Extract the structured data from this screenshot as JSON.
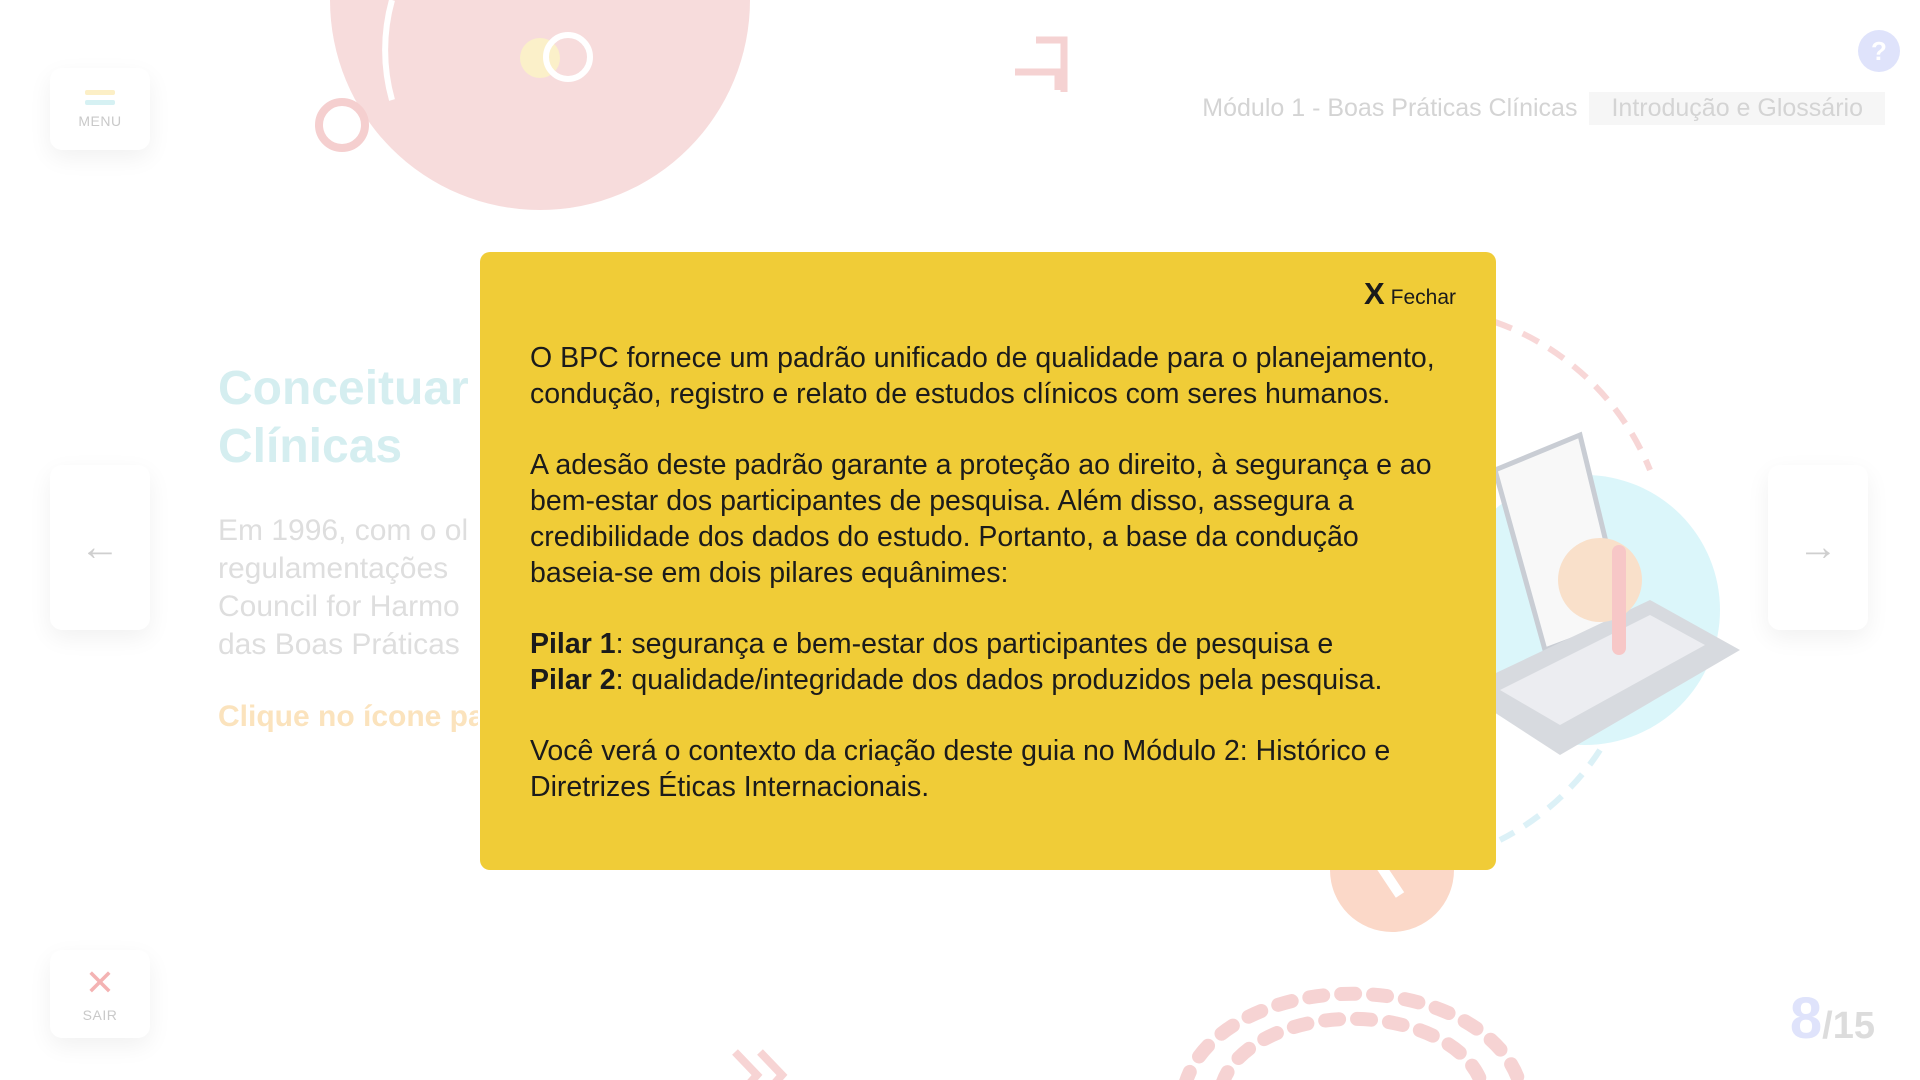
{
  "header": {
    "module_title": "Módulo 1 - Boas Práticas Clínicas",
    "section_title": "Introdução e Glossário",
    "help_label": "?"
  },
  "sidebar": {
    "menu_label": "MENU",
    "exit_label": "SAIR",
    "exit_glyph": "✕"
  },
  "navigation": {
    "prev_glyph": "←",
    "next_glyph": "→"
  },
  "page": {
    "heading_line1": "Conceituar",
    "heading_line2": "Clínicas",
    "body_line1": "Em 1996, com o ol",
    "body_line2": "regulamentações",
    "body_line3": "Council for Harmo",
    "body_line4": "das Boas Práticas",
    "cta": "Clique no ícone pa"
  },
  "pager": {
    "current": "8",
    "separator": "/",
    "total": "15"
  },
  "modal": {
    "close_glyph": "X",
    "close_label": "Fechar",
    "paragraph1": "O BPC fornece um padrão unificado de qualidade para o planejamento, condução, registro e relato de estudos clínicos com seres humanos.",
    "paragraph2": "A adesão deste padrão garante a proteção ao direito, à segurança e ao bem-estar dos participantes de pesquisa. Além disso, assegura a credibilidade dos dados do estudo. Portanto, a base da condução baseia-se em dois pilares equânimes:",
    "pillar1_label": "Pilar 1",
    "pillar1_text": ": segurança e bem-estar dos participantes de pesquisa e",
    "pillar2_label": "Pilar 2",
    "pillar2_text": ": qualidade/integridade dos dados produzidos pela pesquisa.",
    "paragraph4": "Você verá o contexto da criação deste guia no Módulo 2: Histórico e Diretrizes Éticas Internacionais."
  },
  "colors": {
    "modal_background": "#f0cc37",
    "heading_faded": "#d5eef0",
    "accent_pink": "#f4c6c6",
    "accent_blue": "#dfe3fb"
  }
}
